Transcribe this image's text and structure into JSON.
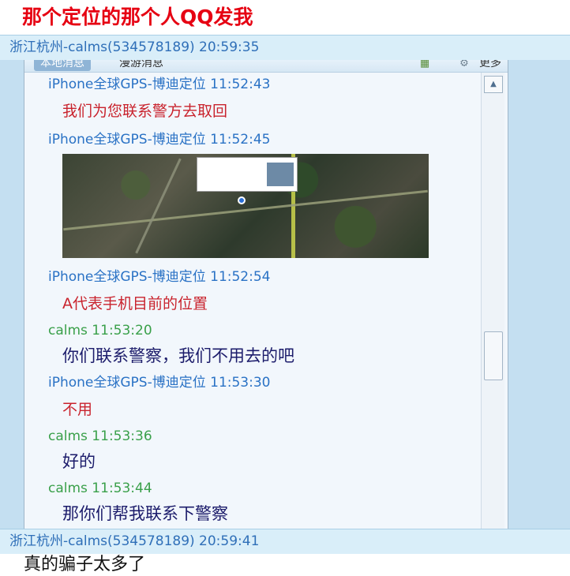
{
  "headline": "那个定位的那个人QQ发我",
  "messages": [
    {
      "header": "浙江杭州-calms(534578189) 20:59:35"
    },
    {
      "header": "浙江杭州-calms(534578189) 20:59:41",
      "text": "真的骗子太多了"
    }
  ],
  "embedded": {
    "toolbar": {
      "tab": "本地消息",
      "tab2": "漫游消息",
      "more": "更多",
      "icon_a": "chart-icon",
      "icon_b": "settings-icon"
    },
    "chat": [
      {
        "sender": "iPhone全球GPS-博迪定位 11:52:43",
        "text": "我们为您联系警方去取回"
      },
      {
        "sender": "iPhone全球GPS-博迪定位 11:52:45",
        "image": "map-screenshot"
      },
      {
        "sender": "iPhone全球GPS-博迪定位 11:52:54",
        "text": "A代表手机目前的位置"
      },
      {
        "sender": "calms 11:53:20",
        "text": "你们联系警察，我们不用去的吧"
      },
      {
        "sender": "iPhone全球GPS-博迪定位 11:53:30",
        "text": "不用"
      },
      {
        "sender": "calms 11:53:36",
        "text": "好的"
      },
      {
        "sender": "calms 11:53:44",
        "text": "那你们帮我联系下警察"
      }
    ]
  },
  "colors": {
    "headline": "#e60012",
    "header_text": "#2f6fb8",
    "header_bg": "#d9eef9",
    "service_sender": "#2a72c5",
    "user_sender": "#3aa04a",
    "service_text": "#c9232d",
    "user_text": "#1c1c6b"
  }
}
